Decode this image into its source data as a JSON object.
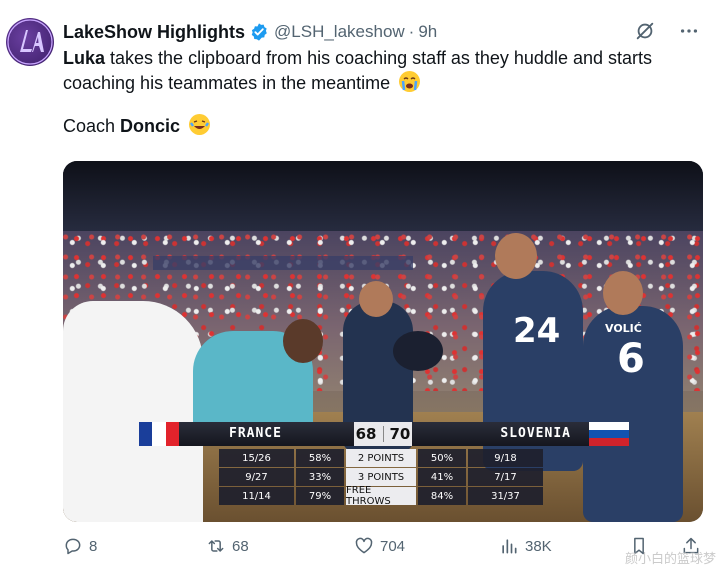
{
  "tweet": {
    "display_name": "LakeShow Highlights",
    "handle": "@LSH_lakeshow",
    "separator": "·",
    "time": "9h",
    "text_bold1": "Luka",
    "text_rest": " takes the clipboard from his coaching staff as they huddle and starts coaching his teammates in the meantime",
    "text_line2_prefix": "Coach ",
    "text_line2_bold": "Doncic"
  },
  "scoreboard": {
    "team_left": "FRANCE",
    "team_right": "SLOVENIA",
    "score_left": "68",
    "score_right": "70",
    "rows": [
      {
        "left_made": "15/26",
        "left_pct": "58%",
        "label": "2 POINTS",
        "right_pct": "50%",
        "right_made": "9/18"
      },
      {
        "left_made": "9/27",
        "left_pct": "33%",
        "label": "3 POINTS",
        "right_pct": "41%",
        "right_made": "7/17"
      },
      {
        "left_made": "11/14",
        "left_pct": "79%",
        "label": "FREE THROWS",
        "right_pct": "84%",
        "right_made": "31/37"
      }
    ]
  },
  "jerseys": {
    "n24": "24",
    "n6": "6",
    "name_back": "VOLIĆ"
  },
  "actions": {
    "replies": "8",
    "reposts": "68",
    "likes": "704",
    "views": "38K"
  },
  "watermark": "颜小白的篮球梦",
  "colors": {
    "verified": "#1d9bf0",
    "text_secondary": "#536471",
    "avatar": "#4a2a80"
  }
}
